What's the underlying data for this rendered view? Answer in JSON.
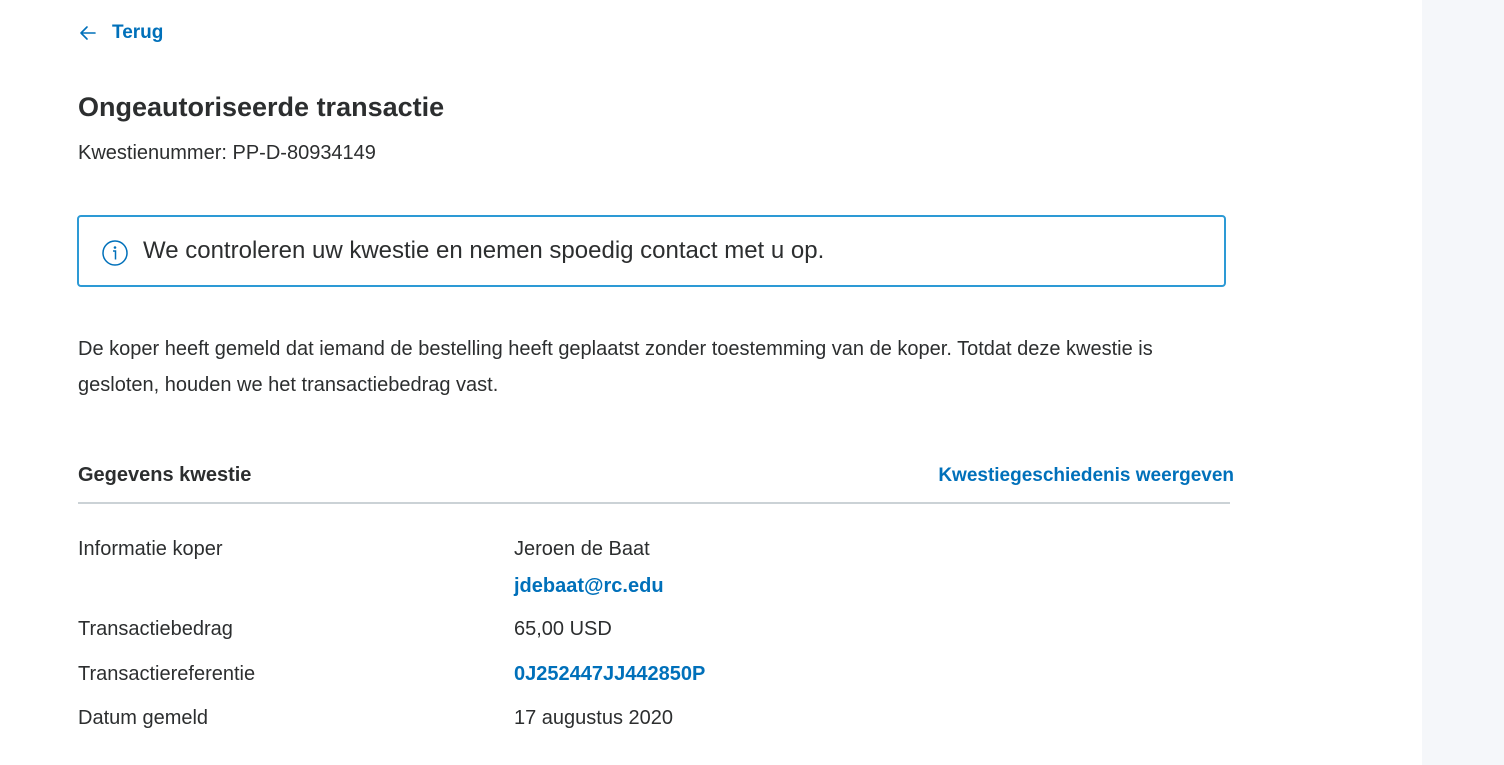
{
  "nav": {
    "back_label": "Terug",
    "back_icon": "arrow-left-icon"
  },
  "case": {
    "title": "Ongeautoriseerde transactie",
    "number_label": "Kwestienummer:",
    "number_value": "PP-D-80934149"
  },
  "alert": {
    "icon": "info-icon",
    "message": "We controleren uw kwestie en nemen spoedig contact met u op."
  },
  "description": "De koper heeft gemeld dat iemand de bestelling heeft geplaatst zonder toestemming van de koper. Totdat deze kwestie is gesloten, houden we het transactiebedrag vast.",
  "details": {
    "section_title": "Gegevens kwestie",
    "history_link": "Kwestiegeschiedenis weergeven",
    "rows": [
      {
        "label": "Informatie koper",
        "value": "Jeroen de Baat",
        "link": "jdebaat@rc.edu"
      },
      {
        "label": "Transactiebedrag",
        "value": "65,00 USD"
      },
      {
        "label": "Transactiereferentie",
        "link": "0J252447JJ442850P"
      },
      {
        "label": "Datum gemeld",
        "value": "17 augustus 2020"
      }
    ]
  },
  "colors": {
    "link": "#0070ba",
    "alert_border": "#2d9ad5",
    "text": "#2c2e2f",
    "divider": "#cbd2d6",
    "side_panel": "#f5f7fa"
  }
}
